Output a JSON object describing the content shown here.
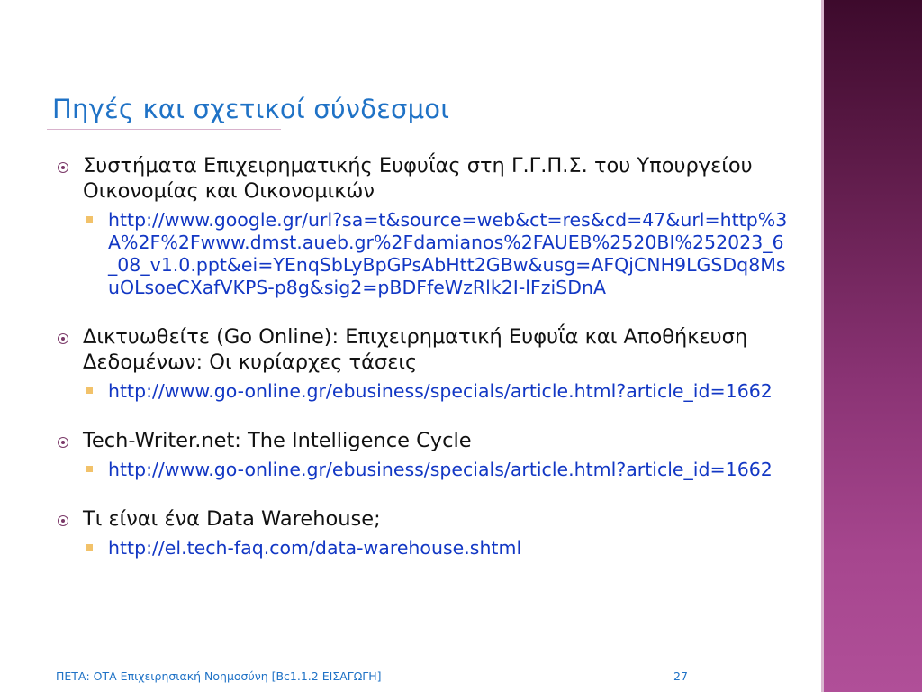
{
  "slide": {
    "title": "Πηγές και σχετικοί σύνδεσμοι",
    "items": [
      {
        "text": "Συστήματα Επιχειρηματικής Ευφυΐας στη  Γ.Γ.Π.Σ. του Υπουργείου Οικονομίας και Οικονομικών",
        "link": "http://www.google.gr/url?sa=t&source=web&ct=res&cd=47&url=http%3A%2F%2Fwww.dmst.aueb.gr%2Fdamianos%2FAUEB%2520BI%252023_6_08_v1.0.ppt&ei=YEnqSbLyBpGPsAbHtt2GBw&usg=AFQjCNH9LGSDq8MsuOLsoeCXafVKPS-p8g&sig2=pBDFfeWzRlk2I-lFziSDnA"
      },
      {
        "text": "Δικτυωθείτε (Go Online): Επιχειρηματική Ευφυΐα και Αποθήκευση Δεδομένων: Οι κυρίαρχες τάσεις",
        "link": "http://www.go-online.gr/ebusiness/specials/article.html?article_id=1662"
      },
      {
        "text": "Tech-Writer.net: The Intelligence Cycle",
        "link": "http://www.go-online.gr/ebusiness/specials/article.html?article_id=1662"
      },
      {
        "text": "Τι είναι ένα Data Warehouse;",
        "link": "http://el.tech-faq.com/data-warehouse.shtml"
      }
    ],
    "footer": "ΠΕΤΑ: ΟΤΑ Επιχειρησιακή Νοημοσύνη [Βc1.1.2 ΕΙΣΑΓΩΓΗ]",
    "page_number": "27"
  },
  "colors": {
    "title": "#1f72c6",
    "link": "#1237c4",
    "bullet": "#7a3868",
    "sub_bullet": "#f2c26a",
    "side_band": "#8a3374"
  },
  "icons": {
    "bullet": "circle-bullet-icon",
    "sub_bullet": "square-bullet-icon"
  }
}
